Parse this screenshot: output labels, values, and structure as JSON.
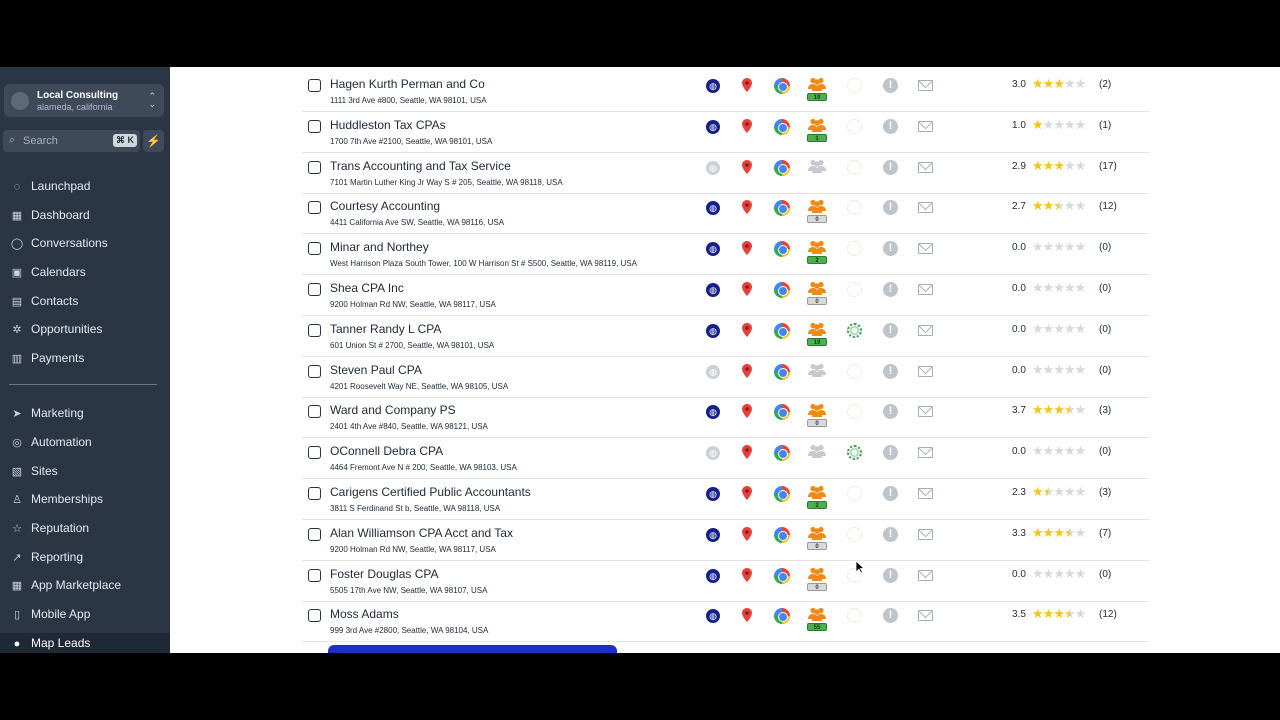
{
  "account": {
    "name": "Local Consulting",
    "location": "alameda, california"
  },
  "search": {
    "placeholder": "Search",
    "shortcut": "⌘ K"
  },
  "nav": {
    "launchpad": "Launchpad",
    "dashboard": "Dashboard",
    "conversations": "Conversations",
    "calendars": "Calendars",
    "contacts": "Contacts",
    "opportunities": "Opportunities",
    "payments": "Payments",
    "marketing": "Marketing",
    "automation": "Automation",
    "sites": "Sites",
    "memberships": "Memberships",
    "reputation": "Reputation",
    "reporting": "Reporting",
    "app_marketplace": "App Marketplace",
    "mobile_app": "Mobile App",
    "map_leads": "Map Leads"
  },
  "colors": {
    "sidebar": "#2b3645",
    "accent_button": "#1d2fc5",
    "star": "#f5c518"
  },
  "leads": [
    {
      "name": "Hagen Kurth Perman and Co",
      "address": "1111 3rd Ave #800, Seattle, WA 98101, USA",
      "website": true,
      "employees": "19",
      "employees_color": "green",
      "verified": false,
      "rating": "3.0",
      "stars": 3,
      "reviews": "(2)"
    },
    {
      "name": "Huddleston Tax CPAs",
      "address": "1700 7th Ave #2100, Seattle, WA 98101, USA",
      "website": true,
      "employees": "1",
      "employees_color": "green",
      "verified": false,
      "rating": "1.0",
      "stars": 1,
      "reviews": "(1)"
    },
    {
      "name": "Trans Accounting and Tax Service",
      "address": "7101 Martin Luther King Jr Way S # 205, Seattle, WA 98118, USA",
      "website": false,
      "employees": "",
      "employees_color": "none",
      "verified": false,
      "rating": "2.9",
      "stars": 3,
      "reviews": "(17)"
    },
    {
      "name": "Courtesy Accounting",
      "address": "4411 California Ave SW, Seattle, WA 98116, USA",
      "website": true,
      "employees": "0",
      "employees_color": "gray",
      "verified": false,
      "rating": "2.7",
      "stars": 2.5,
      "reviews": "(12)"
    },
    {
      "name": "Minar and Northey",
      "address": "West Harrison Plaza South Tower, 100 W Harrison St # S500, Seattle, WA 98119, USA",
      "website": true,
      "employees": "2",
      "employees_color": "green",
      "verified": false,
      "rating": "0.0",
      "stars": 0,
      "reviews": "(0)"
    },
    {
      "name": "Shea CPA Inc",
      "address": "9200 Holman Rd NW, Seattle, WA 98117, USA",
      "website": true,
      "employees": "0",
      "employees_color": "gray",
      "verified": false,
      "rating": "0.0",
      "stars": 0,
      "reviews": "(0)"
    },
    {
      "name": "Tanner Randy L CPA",
      "address": "601 Union St # 2700, Seattle, WA 98101, USA",
      "website": true,
      "employees": "19",
      "employees_color": "green",
      "verified": true,
      "rating": "0.0",
      "stars": 0,
      "reviews": "(0)"
    },
    {
      "name": "Steven Paul CPA",
      "address": "4201 Roosevelt Way NE, Seattle, WA 98105, USA",
      "website": false,
      "employees": "",
      "employees_color": "none",
      "verified": false,
      "rating": "0.0",
      "stars": 0,
      "reviews": "(0)"
    },
    {
      "name": "Ward and Company PS",
      "address": "2401 4th Ave #840, Seattle, WA 98121, USA",
      "website": true,
      "employees": "0",
      "employees_color": "gray",
      "verified": false,
      "rating": "3.7",
      "stars": 3.5,
      "reviews": "(3)"
    },
    {
      "name": "OConnell Debra CPA",
      "address": "4464 Fremont Ave N # 200, Seattle, WA 98103, USA",
      "website": false,
      "employees": "",
      "employees_color": "none",
      "verified": true,
      "rating": "0.0",
      "stars": 0,
      "reviews": "(0)"
    },
    {
      "name": "Carigens Certified Public Accountants",
      "address": "3811 S Ferdinand St b, Seattle, WA 98118, USA",
      "website": true,
      "employees": "2",
      "employees_color": "green",
      "verified": false,
      "rating": "2.3",
      "stars": 1.5,
      "reviews": "(3)"
    },
    {
      "name": "Alan Williamson CPA Acct and Tax",
      "address": "9200 Holman Rd NW, Seattle, WA 98117, USA",
      "website": true,
      "employees": "0",
      "employees_color": "gray",
      "verified": false,
      "rating": "3.3",
      "stars": 3.5,
      "reviews": "(7)"
    },
    {
      "name": "Foster Douglas CPA",
      "address": "5505 17th Ave NW, Seattle, WA 98107, USA",
      "website": true,
      "employees": "0",
      "employees_color": "gray",
      "verified": false,
      "rating": "0.0",
      "stars": 0,
      "reviews": "(0)"
    },
    {
      "name": "Moss Adams",
      "address": "999 3rd Ave #2800, Seattle, WA 98104, USA",
      "website": true,
      "employees": "55",
      "employees_color": "green",
      "verified": false,
      "rating": "3.5",
      "stars": 3.5,
      "reviews": "(12)"
    }
  ]
}
